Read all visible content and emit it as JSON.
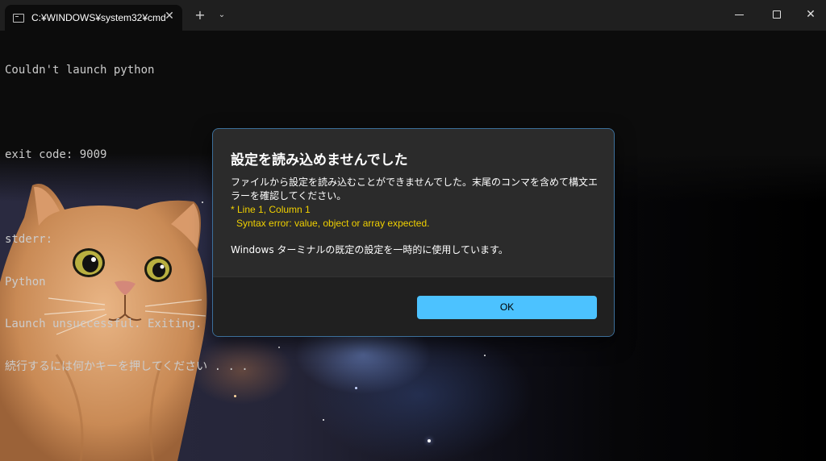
{
  "window": {
    "tab_title": "C:¥WINDOWS¥system32¥cmd",
    "tab_close_glyph": "✕",
    "new_tab_glyph": "+",
    "dropdown_glyph": "⌄",
    "close_glyph": "✕"
  },
  "terminal": {
    "lines": [
      "Couldn't launch python",
      "",
      "exit code: 9009",
      "",
      "stderr:",
      "Python",
      "Launch unsuccessful. Exiting.",
      "続行するには何かキーを押してください . . ."
    ]
  },
  "dialog": {
    "title": "設定を読み込めませんでした",
    "message": "ファイルから設定を読み込むことができませんでした。末尾のコンマを含めて構文エラーを確認してください。",
    "error_line1": "* Line 1, Column 1",
    "error_line2": "Syntax error: value, object or array expected.",
    "note": "Windows ターミナルの既定の設定を一時的に使用しています。",
    "ok_label": "OK"
  },
  "icons": [
    "terminal-icon",
    "close-icon",
    "plus-icon",
    "chevron-down-icon",
    "minimize-icon",
    "maximize-icon"
  ],
  "colors": {
    "accent": "#4cc2ff",
    "error_text": "#f0d000",
    "terminal_bg": "#0c0c0c"
  }
}
